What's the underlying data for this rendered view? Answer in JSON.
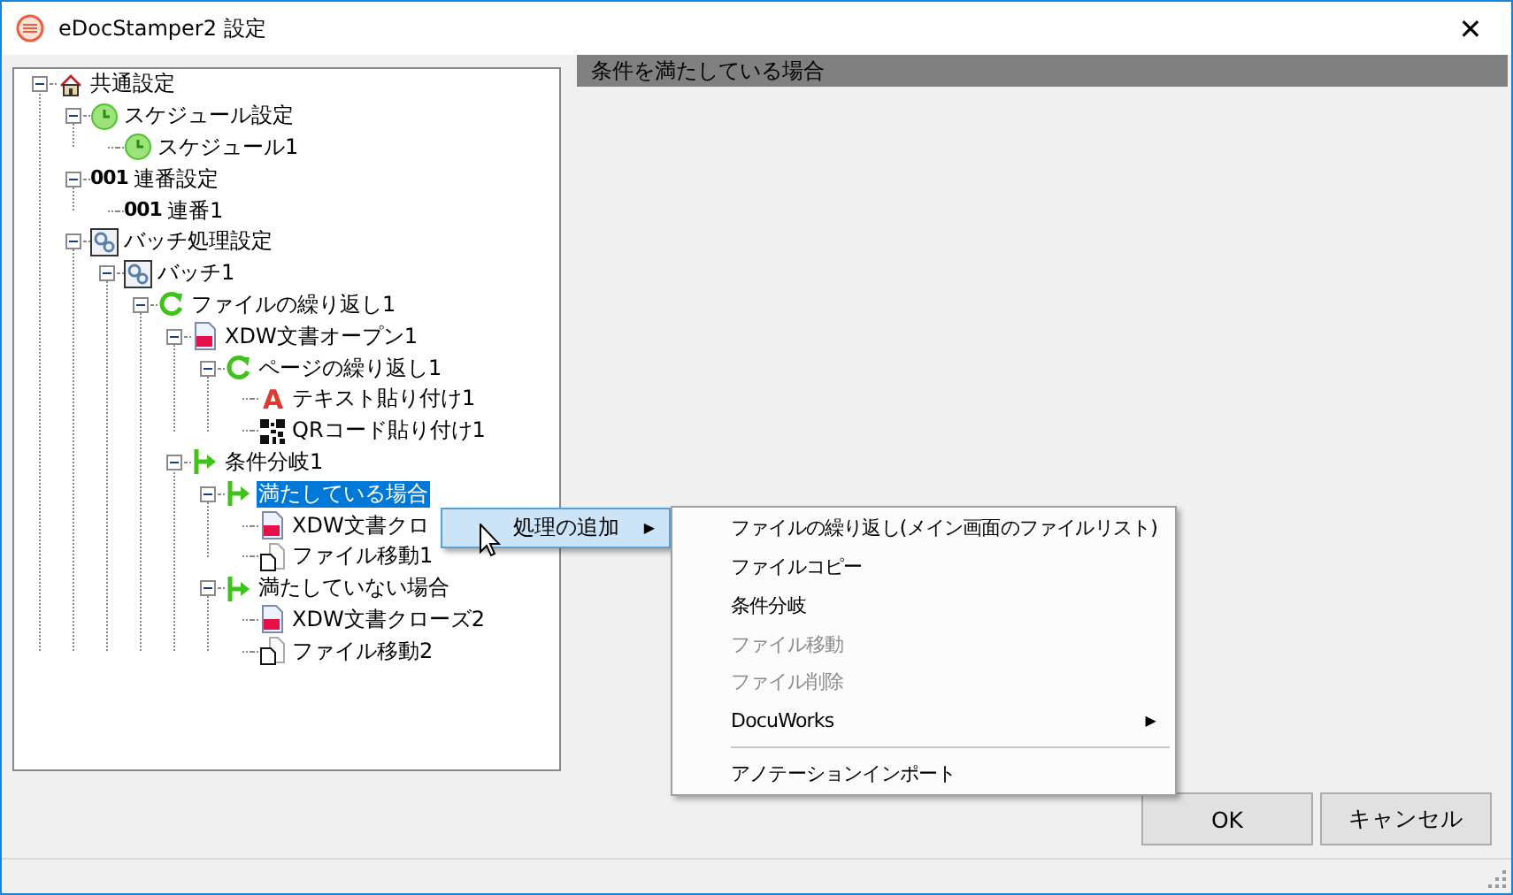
{
  "window": {
    "title": "eDocStamper2 設定",
    "close": "✕"
  },
  "tree": [
    {
      "label": "共通設定",
      "kind": "house",
      "expanded": true,
      "selected": false,
      "children": [
        {
          "label": "スケジュール設定",
          "kind": "clock",
          "expanded": true,
          "selected": false,
          "children": [
            {
              "label": "スケジュール1",
              "kind": "clock",
              "selected": false
            }
          ]
        },
        {
          "label": "連番設定",
          "kind": "number",
          "badge": "001",
          "expanded": true,
          "selected": false,
          "children": [
            {
              "label": "連番1",
              "kind": "number",
              "badge": "001",
              "selected": false
            }
          ]
        },
        {
          "label": "バッチ処理設定",
          "kind": "gears",
          "expanded": true,
          "selected": false,
          "children": [
            {
              "label": "バッチ1",
              "kind": "gears",
              "expanded": true,
              "selected": false,
              "children": [
                {
                  "label": "ファイルの繰り返し1",
                  "kind": "loop",
                  "expanded": true,
                  "selected": false,
                  "children": [
                    {
                      "label": "XDW文書オープン1",
                      "kind": "doc",
                      "expanded": true,
                      "selected": false,
                      "children": [
                        {
                          "label": "ページの繰り返し1",
                          "kind": "loop",
                          "expanded": true,
                          "selected": false,
                          "children": [
                            {
                              "label": "テキスト貼り付け1",
                              "kind": "letter",
                              "badge": "A",
                              "selected": false
                            },
                            {
                              "label": "QRコード貼り付け1",
                              "kind": "qr",
                              "selected": false
                            }
                          ]
                        }
                      ]
                    },
                    {
                      "label": "条件分岐1",
                      "kind": "branch",
                      "expanded": true,
                      "selected": false,
                      "children": [
                        {
                          "label": "満たしている場合",
                          "kind": "branch",
                          "expanded": true,
                          "selected": true,
                          "children": [
                            {
                              "label": "XDW文書クロ",
                              "kind": "doc",
                              "selected": false
                            },
                            {
                              "label": "ファイル移動1",
                              "kind": "file",
                              "selected": false
                            }
                          ]
                        },
                        {
                          "label": "満たしていない場合",
                          "kind": "branch",
                          "expanded": true,
                          "selected": false,
                          "children": [
                            {
                              "label": "XDW文書クローズ2",
                              "kind": "doc",
                              "selected": false
                            },
                            {
                              "label": "ファイル移動2",
                              "kind": "file",
                              "selected": false
                            }
                          ]
                        }
                      ]
                    }
                  ]
                }
              ]
            }
          ]
        }
      ]
    }
  ],
  "panel": {
    "header": "条件を満たしている場合"
  },
  "context_menu": {
    "label": "処理の追加",
    "arrow": "▶",
    "highlighted": true
  },
  "submenu": [
    {
      "label": "ファイルの繰り返し(メイン画面のファイルリスト)",
      "disabled": false
    },
    {
      "label": "ファイルコピー",
      "disabled": false
    },
    {
      "label": "条件分岐",
      "disabled": false
    },
    {
      "label": "ファイル移動",
      "disabled": true
    },
    {
      "label": "ファイル削除",
      "disabled": true
    },
    {
      "label": "DocuWorks",
      "disabled": false,
      "arrow": "▶"
    },
    {
      "label": "アノテーションインポート",
      "disabled": false,
      "separator_before": true
    }
  ],
  "buttons": [
    "OK",
    "キャンセル"
  ]
}
